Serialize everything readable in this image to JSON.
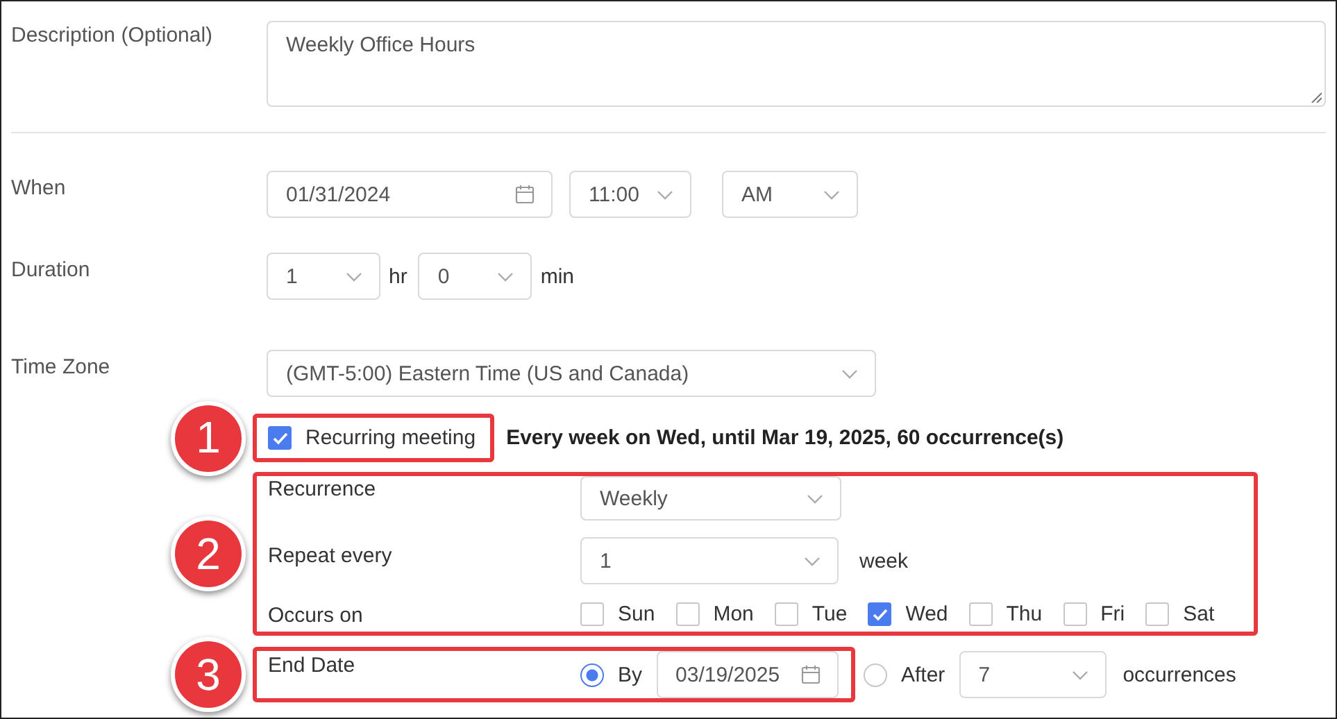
{
  "description": {
    "label": "Description (Optional)",
    "value": "Weekly Office Hours"
  },
  "when": {
    "label": "When",
    "date": "01/31/2024",
    "time": "11:00",
    "period": "AM"
  },
  "duration": {
    "label": "Duration",
    "hours": "1",
    "hours_unit": "hr",
    "minutes": "0",
    "minutes_unit": "min"
  },
  "time_zone": {
    "label": "Time Zone",
    "value": "(GMT-5:00) Eastern Time (US and Canada)"
  },
  "recurring": {
    "label": "Recurring meeting",
    "checked": true,
    "summary": "Every week on Wed, until Mar 19, 2025, 60 occurrence(s)"
  },
  "recurrence": {
    "label": "Recurrence",
    "value": "Weekly"
  },
  "repeat_every": {
    "label": "Repeat every",
    "value": "1",
    "unit": "week"
  },
  "occurs_on": {
    "label": "Occurs on",
    "days": [
      {
        "label": "Sun",
        "checked": false
      },
      {
        "label": "Mon",
        "checked": false
      },
      {
        "label": "Tue",
        "checked": false
      },
      {
        "label": "Wed",
        "checked": true
      },
      {
        "label": "Thu",
        "checked": false
      },
      {
        "label": "Fri",
        "checked": false
      },
      {
        "label": "Sat",
        "checked": false
      }
    ]
  },
  "end_date": {
    "label": "End Date",
    "options": [
      {
        "kind": "date",
        "label": "By",
        "selected": true,
        "value": "03/19/2025"
      },
      {
        "kind": "count",
        "label": "After",
        "selected": false,
        "value": "7",
        "unit": "occurrences"
      }
    ]
  },
  "callouts": [
    "1",
    "2",
    "3"
  ]
}
